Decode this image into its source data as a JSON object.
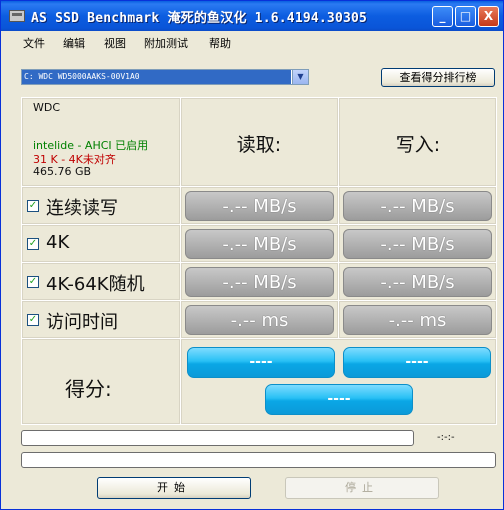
{
  "window": {
    "title": "AS SSD Benchmark 淹死的鱼汉化 1.6.4194.30305",
    "minimize_icon": "_",
    "maximize_icon": "□",
    "close_icon": "X"
  },
  "menu": [
    "文件",
    "编辑",
    "视图",
    "附加测试",
    "帮助"
  ],
  "drive_select": {
    "value": "C: WDC WD5000AAKS-00V1A0",
    "arrow": "▼"
  },
  "rank_button": "查看得分排行榜",
  "drive_info": {
    "name": "WDC",
    "driver": "intelide - AHCI 已启用",
    "alignment": "31 K - 4K未对齐",
    "size": "465.76 GB"
  },
  "columns": {
    "read": "读取:",
    "write": "写入:"
  },
  "rows": [
    {
      "label": "连续读写",
      "checked": "✓",
      "read": "-.-- MB/s",
      "write": "-.-- MB/s"
    },
    {
      "label": "4K",
      "checked": "✓",
      "read": "-.-- MB/s",
      "write": "-.-- MB/s"
    },
    {
      "label": "4K-64K随机",
      "checked": "✓",
      "read": "-.-- MB/s",
      "write": "-.-- MB/s"
    },
    {
      "label": "访问时间",
      "checked": "✓",
      "read": "-.-- ms",
      "write": "-.-- ms"
    }
  ],
  "score": {
    "label": "得分:",
    "read": "----",
    "write": "----",
    "total": "----"
  },
  "progress": {
    "timer": "-:-:-",
    "bar1": 0,
    "bar2": 0
  },
  "buttons": {
    "start": "开始",
    "stop": "停止"
  },
  "colors": {
    "title_bar": "#0a5fe0",
    "score_blue": "#0aa7e6",
    "result_gray": "#9c9c9c",
    "info_green": "#008000",
    "info_red": "#c00000"
  }
}
